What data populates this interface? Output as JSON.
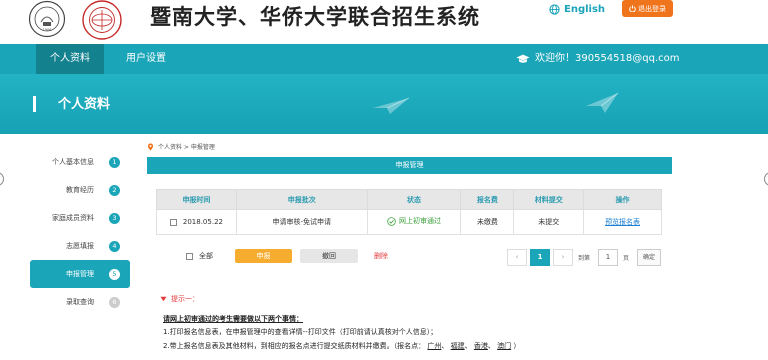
{
  "header": {
    "title": "暨南大学、华侨大学联合招生系统",
    "language": "English",
    "logout": "退出登录"
  },
  "nav": {
    "tabs": [
      {
        "label": "个人资料",
        "active": true
      },
      {
        "label": "用户设置",
        "active": false
      }
    ],
    "welcome": "欢迎你！390554518@qq.com"
  },
  "banner": {
    "title": "个人资料"
  },
  "sidebar": {
    "items": [
      {
        "label": "个人基本信息",
        "num": "1"
      },
      {
        "label": "教育经历",
        "num": "2"
      },
      {
        "label": "家庭成员资料",
        "num": "3"
      },
      {
        "label": "志愿填报",
        "num": "4"
      },
      {
        "label": "申报管理",
        "num": "5"
      },
      {
        "label": "录取查询",
        "num": "6"
      }
    ]
  },
  "breadcrumb": {
    "text": "个人资料 > 申报管理"
  },
  "panel": {
    "title": "申报管理"
  },
  "table": {
    "headers": [
      "申报时间",
      "申报批次",
      "状态",
      "报名费",
      "材料提交",
      "操作"
    ],
    "rows": [
      {
        "date": "2018.05.22",
        "batch": "申请审核-免试申请",
        "status": "网上初审通过",
        "fee": "未缴费",
        "material": "未提交",
        "action": "预览报名表"
      }
    ]
  },
  "actions": {
    "select_all": "全部",
    "apply": "申报",
    "withdraw": "撤回",
    "delete": "删除"
  },
  "pagination": {
    "prev": "‹",
    "current": "1",
    "next": "›",
    "goto_prefix": "到第",
    "goto_value": "1",
    "page_suffix": "页",
    "confirm": "确定"
  },
  "tips": {
    "head": "提示一：",
    "title": "请网上初审通过的考生需要做以下两个事情：",
    "line1": "1.打印报名信息表，在申报管理中的查看详情--打印文件（打印前请认真核对个人信息）；",
    "line2_prefix": "2.带上报名信息表及其他材料，到相应的报名点进行提交纸质材料并缴费。（报名点：",
    "locations": [
      "广州",
      "福建",
      "香港",
      "澳门"
    ],
    "line2_suffix": "）"
  },
  "colors": {
    "teal": "#1ba5b8",
    "teal_dark": "#14818f",
    "orange": "#f0741c",
    "yellow": "#f6ac2f",
    "red": "#e23b3b",
    "green": "#3ca23c"
  }
}
